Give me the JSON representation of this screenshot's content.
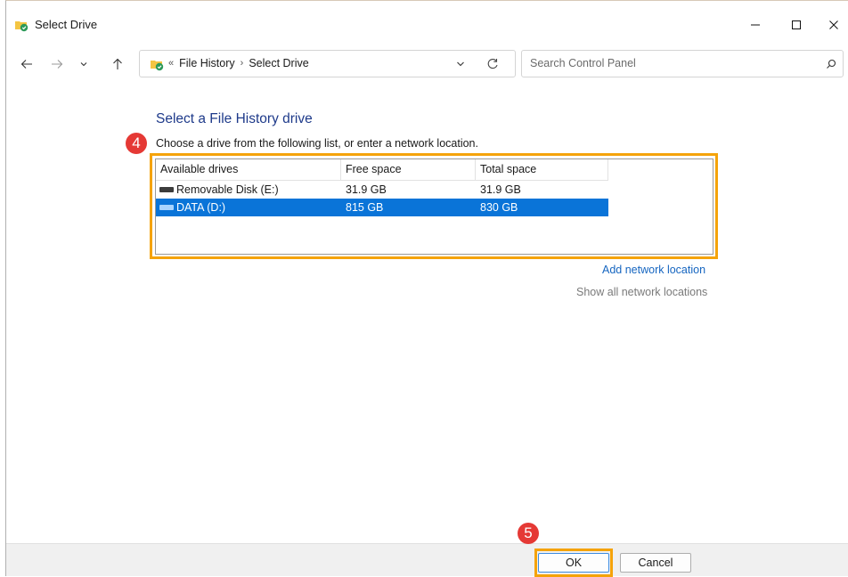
{
  "window": {
    "title": "Select Drive",
    "controls": {
      "minimize": "minimize",
      "maximize": "maximize",
      "close": "close"
    }
  },
  "nav": {
    "breadcrumb_prefix": "«",
    "breadcrumb": [
      "File History",
      "Select Drive"
    ],
    "separator": "›",
    "search_placeholder": "Search Control Panel"
  },
  "content": {
    "heading": "Select a File History drive",
    "instruction": "Choose a drive from the following list, or enter a network location.",
    "badge_list": "4",
    "badge_ok": "5",
    "columns": [
      "Available drives",
      "Free space",
      "Total space"
    ],
    "drives": [
      {
        "name": "Removable Disk (E:)",
        "free": "31.9 GB",
        "total": "31.9 GB",
        "selected": false
      },
      {
        "name": "DATA (D:)",
        "free": "815 GB",
        "total": "830 GB",
        "selected": true
      }
    ],
    "add_network": "Add network location",
    "show_network": "Show all network locations"
  },
  "footer": {
    "ok_label": "OK",
    "cancel_label": "Cancel"
  },
  "colors": {
    "selection": "#0a74d8",
    "highlight": "#f5a30a",
    "badge": "#e53935",
    "heading": "#1e3a8a",
    "link": "#1565c0"
  }
}
